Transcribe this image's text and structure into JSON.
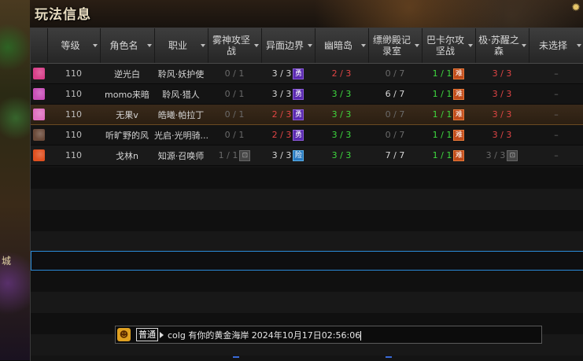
{
  "window": {
    "title": "玩法信息"
  },
  "left_art": {
    "label": "城"
  },
  "headers": [
    "",
    "等级",
    "角色名",
    "职业",
    "雾神攻坚战",
    "异面边界",
    "幽暗岛",
    "缥缈殿记录室",
    "巴卡尔攻坚战",
    "极·苏醒之森",
    "未选择"
  ],
  "rows": [
    {
      "avatar_color": "#d8408a",
      "level": "110",
      "name": "逆光白",
      "class": "聆风·妖护使",
      "fog": "0 / 1",
      "otherworld": "3 / 3",
      "otherworld_badge": "勇",
      "dark_isle": "2 / 3",
      "piaomiao": "0 / 7",
      "bakal": "1 / 1",
      "bakal_badge": "难",
      "forest": "3 / 3",
      "unselected": "–"
    },
    {
      "avatar_color": "#c850b8",
      "level": "110",
      "name": "momo来暗",
      "class": "聆风·猎人",
      "fog": "0 / 1",
      "otherworld": "3 / 3",
      "otherworld_badge": "勇",
      "dark_isle": "3 / 3",
      "piaomiao": "6 / 7",
      "bakal": "1 / 1",
      "bakal_badge": "难",
      "forest": "3 / 3",
      "unselected": "–"
    },
    {
      "avatar_color": "#e070c0",
      "level": "110",
      "name": "无果v",
      "class": "皓曦·帕拉丁",
      "fog": "0 / 1",
      "otherworld": "2 / 3",
      "otherworld_badge": "勇",
      "dark_isle": "3 / 3",
      "piaomiao": "0 / 7",
      "bakal": "1 / 1",
      "bakal_badge": "难",
      "forest": "3 / 3",
      "unselected": "–"
    },
    {
      "avatar_color": "#6a4a3a",
      "level": "110",
      "name": "听旷野的风",
      "class": "光启·光明骑...",
      "fog": "0 / 1",
      "otherworld": "2 / 3",
      "otherworld_badge": "勇",
      "dark_isle": "3 / 3",
      "piaomiao": "0 / 7",
      "bakal": "1 / 1",
      "bakal_badge": "难",
      "forest": "3 / 3",
      "unselected": "–"
    },
    {
      "avatar_color": "#e05020",
      "level": "110",
      "name": "戈林n",
      "class": "知源·召唤师",
      "fog": "1 / 1",
      "fog_badge": "⊡",
      "otherworld": "3 / 3",
      "otherworld_badge": "险",
      "dark_isle": "3 / 3",
      "piaomiao": "7 / 7",
      "bakal": "1 / 1",
      "bakal_badge": "难",
      "forest": "3 / 3",
      "forest_badge": "⊡",
      "unselected": "–"
    }
  ],
  "colors": {
    "red": "#e04545",
    "green": "#3ed83e",
    "grey": "#6a6a6a",
    "white": "#d8d8d8"
  },
  "chat": {
    "icon": "emote-icon",
    "channel": "普通",
    "message": "colg 有你的黄金海岸 2024年10月17日02:56:06"
  }
}
